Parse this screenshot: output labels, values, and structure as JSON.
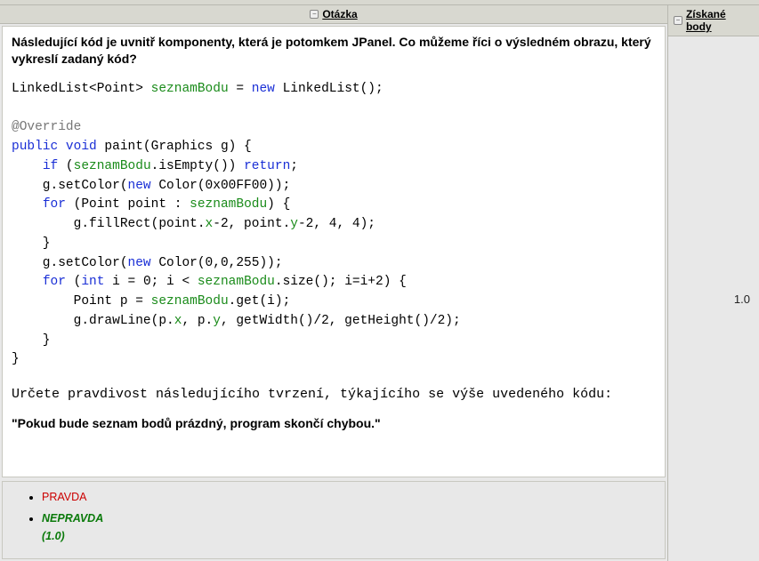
{
  "columns": {
    "question_title": "Otázka",
    "score_title": "Získané body"
  },
  "collapse_glyph": "−",
  "question": {
    "prompt": "Následující kód je uvnitř komponenty, která je potomkem JPanel. Co můžeme říci o výsledném obrazu, který vykreslí zadaný kód?",
    "code": {
      "l01_a": "LinkedList<Point> ",
      "l01_b": "seznamBodu",
      "l01_c": " = ",
      "l01_d": "new",
      "l01_e": " LinkedList();",
      "l03": "@Override",
      "l04_a": "public void",
      "l04_b": " paint(Graphics g) {",
      "l05_a": "    ",
      "l05_b": "if",
      "l05_c": " (",
      "l05_d": "seznamBodu",
      "l05_e": ".isEmpty()) ",
      "l05_f": "return",
      "l05_g": ";",
      "l06_a": "    g.setColor(",
      "l06_b": "new",
      "l06_c": " Color(0x00FF00));",
      "l07_a": "    ",
      "l07_b": "for",
      "l07_c": " (Point point : ",
      "l07_d": "seznamBodu",
      "l07_e": ") {",
      "l08_a": "        g.fillRect(point.",
      "l08_b": "x",
      "l08_c": "-2, point.",
      "l08_d": "y",
      "l08_e": "-2, 4, 4);",
      "l09": "    }",
      "l10_a": "    g.setColor(",
      "l10_b": "new",
      "l10_c": " Color(0,0,255));",
      "l11_a": "    ",
      "l11_b": "for",
      "l11_c": " (",
      "l11_d": "int",
      "l11_e": " i = 0; i < ",
      "l11_f": "seznamBodu",
      "l11_g": ".size(); i=i+2) {",
      "l12_a": "        Point p = ",
      "l12_b": "seznamBodu",
      "l12_c": ".get(i);",
      "l13_a": "        g.drawLine(p.",
      "l13_b": "x",
      "l13_c": ", p.",
      "l13_d": "y",
      "l13_e": ", getWidth()/2, getHeight()/2);",
      "l14": "    }",
      "l15": "}"
    },
    "sub_instruction": "Určete pravdivost následujícího tvrzení, týkajícího se výše uvedeného kódu:",
    "statement": "\"Pokud bude seznam bodů prázdný, program skončí chybou.\"",
    "options": {
      "wrong": "PRAVDA",
      "correct": "NEPRAVDA",
      "correct_score": "(1.0)"
    }
  },
  "score": "1.0"
}
